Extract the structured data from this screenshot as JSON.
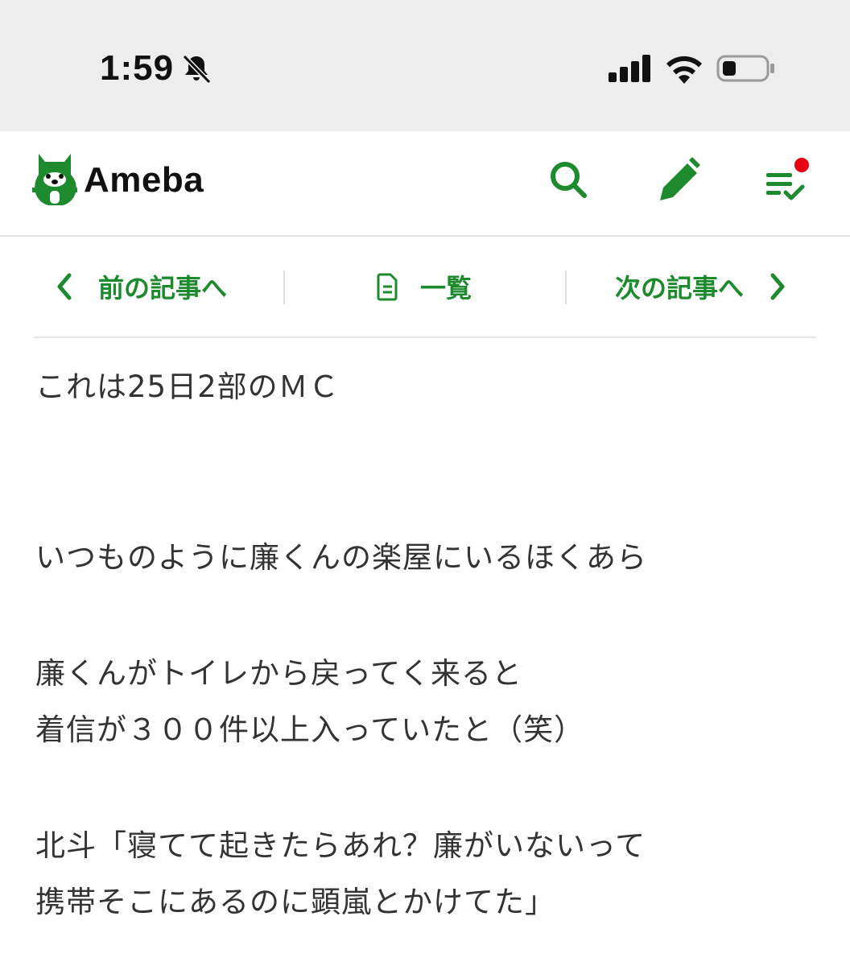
{
  "status_bar": {
    "time": "1:59",
    "icons": [
      "bell-slash-icon",
      "cellular-signal-icon",
      "wifi-icon",
      "battery-icon"
    ]
  },
  "header": {
    "logo_text": "Ameba",
    "brand_color": "#1d8a2e",
    "notification_dot_color": "#e60012",
    "icons": [
      "search-icon",
      "pencil-icon",
      "checklist-icon"
    ]
  },
  "nav": {
    "prev_label": "前の記事へ",
    "list_label": "一覧",
    "next_label": "次の記事へ"
  },
  "article": {
    "paragraphs": [
      "これは25日2部のＭＣ",
      "いつものように廉くんの楽屋にいるほくあら",
      "廉くんがトイレから戻ってく来ると",
      "着信が３００件以上入っていたと（笑）",
      "北斗「寝てて起きたらあれ？廉がいないって",
      "携帯そこにあるのに顕嵐とかけてた」"
    ]
  }
}
